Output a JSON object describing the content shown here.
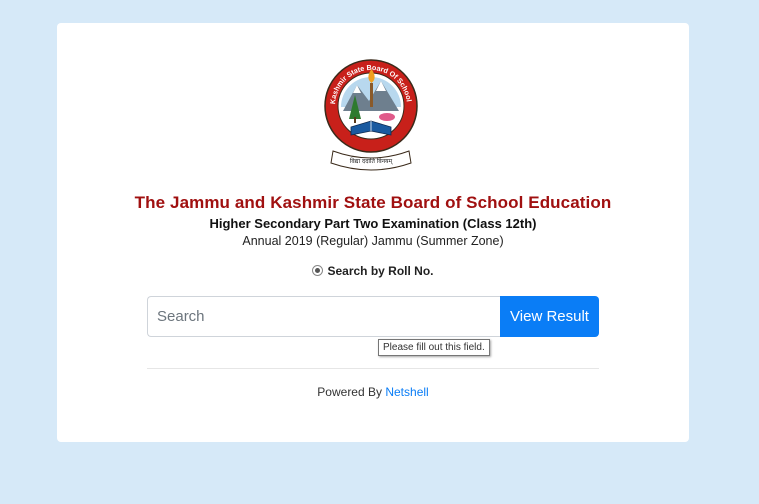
{
  "logo": {
    "ring_text": "Jammu & Kashmir State Board Of School Education",
    "motto": "विद्या ददाति विनयम्",
    "colors": {
      "ring": "#c8201a",
      "outline": "#3a2a1a",
      "sky": "#b8d8ee"
    }
  },
  "header": {
    "title": "The Jammu and Kashmir State Board of School Education",
    "subtitle": "Higher Secondary Part Two Examination (Class 12th)",
    "session": "Annual 2019 (Regular) Jammu (Summer Zone)"
  },
  "search": {
    "option_label": "Search by Roll No.",
    "placeholder": "Search",
    "button_label": "View Result",
    "tooltip": "Please fill out this field."
  },
  "footer": {
    "prefix": "Powered By",
    "link_text": "Netshell"
  },
  "colors": {
    "background": "#d6e9f8",
    "title": "#a01010",
    "button": "#0a7df6"
  }
}
